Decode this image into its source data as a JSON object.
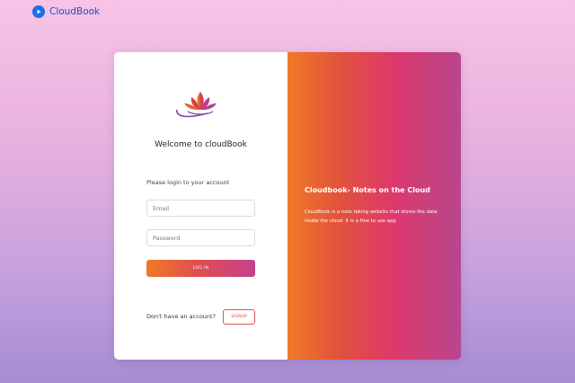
{
  "brand": {
    "name": "CloudBook"
  },
  "login": {
    "welcome": "Welcome to cloudBook",
    "hint": "Please login to your account",
    "email_placeholder": "Email",
    "password_placeholder": "Password",
    "login_button": "LOG IN",
    "no_account_text": "Don't have an account?",
    "signup_button": "SIGNUP"
  },
  "promo": {
    "title": "Cloudbook- Notes on the Cloud",
    "description": "CloudBook is a note taking website that stores the data inside the cloud. It is a free to use app"
  },
  "colors": {
    "brand_blue": "#1a6df0",
    "gradient_start": "#ef7a28",
    "gradient_mid": "#dd3a6a",
    "gradient_end": "#b8468f",
    "signup_red": "#d9534f"
  },
  "icons": {
    "brand_logo": "play-circle-icon",
    "card_logo": "lotus-icon"
  }
}
